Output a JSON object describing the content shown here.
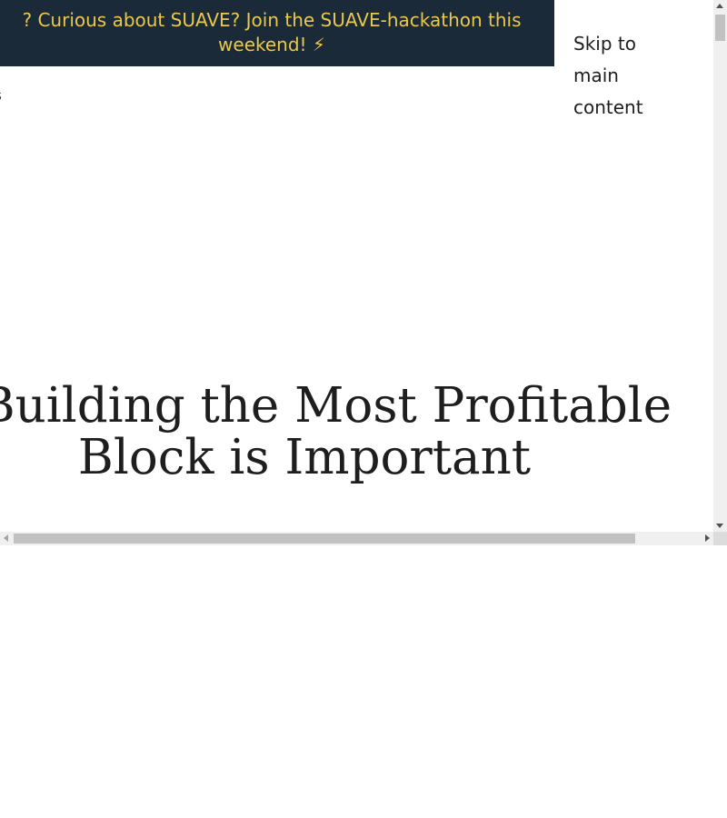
{
  "announcement": {
    "prefix": "? ",
    "text": "Curious about SUAVE? Join the SUAVE-hackathon this weekend! ⚡"
  },
  "skip_link": {
    "label": "Skip to main content"
  },
  "nav": {
    "fragment": "s"
  },
  "article": {
    "title_line1": "y Building the Most Profitable",
    "title_line2": "Block is Important"
  },
  "colors": {
    "banner_bg": "#1b2a38",
    "banner_text": "#e9c84e",
    "text": "#1e1e1e"
  },
  "icons": {
    "scroll_up": "triangle-up",
    "scroll_down": "triangle-down",
    "scroll_left": "triangle-left",
    "scroll_right": "triangle-right"
  }
}
